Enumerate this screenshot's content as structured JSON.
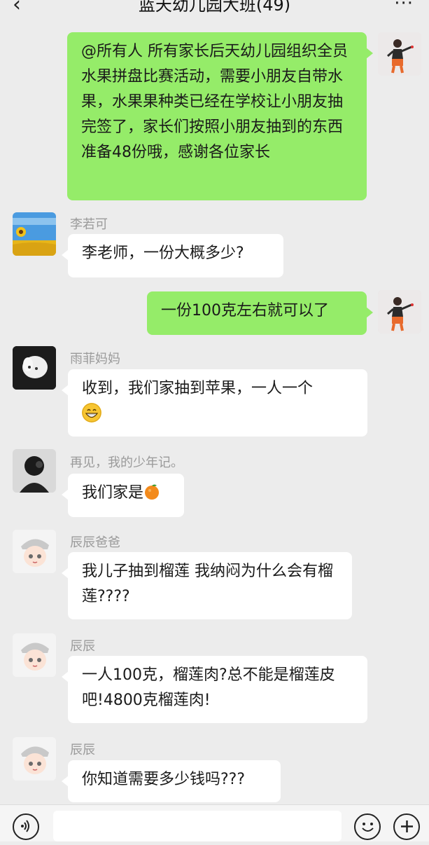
{
  "header": {
    "back_icon": "chevron-left-icon",
    "title": "蓝天幼儿园大班(49)",
    "more_icon": "more-dots-icon"
  },
  "messages": [
    {
      "side": "right",
      "sender": "",
      "text": "@所有人 所有家长后天幼儿园组织全员水果拼盘比赛活动，需要小朋友自带水果，水果果种类已经在学校让小朋友抽完签了，家长们按照小朋友抽到的东西准备48份哦，感谢各位家长"
    },
    {
      "side": "left",
      "sender": "李若可",
      "text": "李老师，一份大概多少?"
    },
    {
      "side": "right",
      "sender": "",
      "text": "一份100克左右就可以了"
    },
    {
      "side": "left",
      "sender": "雨菲妈妈",
      "text": "收到，我们家抽到苹果，一人一个",
      "emoji": "grinning-face-icon"
    },
    {
      "side": "left",
      "sender": "再见，我的少年记。",
      "text": "我们家是",
      "emoji": "tangerine-icon"
    },
    {
      "side": "left",
      "sender": "辰辰爸爸",
      "text": "我儿子抽到榴莲 我纳闷为什么会有榴莲????"
    },
    {
      "side": "left",
      "sender": "辰辰",
      "text": "一人100克，榴莲肉?总不能是榴莲皮吧!4800克榴莲肉!"
    },
    {
      "side": "left",
      "sender": "辰辰",
      "text": "你知道需要多少钱吗???"
    }
  ],
  "input_bar": {
    "voice_icon": "voice-icon",
    "input_value": "",
    "emoji_icon": "smiley-icon",
    "plus_icon": "plus-icon"
  },
  "colors": {
    "background": "#ececec",
    "bubble_sent": "#95ec69",
    "bubble_received": "#ffffff",
    "nickname": "#9a9a9a"
  }
}
